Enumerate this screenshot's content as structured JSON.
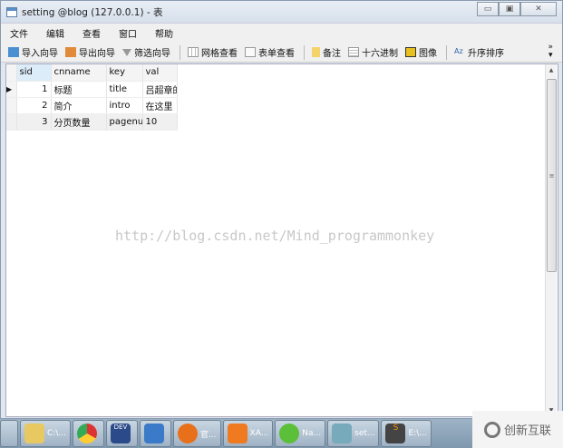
{
  "window": {
    "title": "setting @blog (127.0.0.1) - 表",
    "minimize": "▭",
    "maximize": "▣",
    "close": "✕"
  },
  "menu": [
    "文件",
    "编辑",
    "查看",
    "窗口",
    "帮助"
  ],
  "toolbar": {
    "import": "导入向导",
    "export": "导出向导",
    "filter": "筛选向导",
    "grid_view": "网格查看",
    "form_view": "表单查看",
    "memo": "备注",
    "hex": "十六进制",
    "image": "图像",
    "sort_asc": "升序排序",
    "more": "»"
  },
  "table": {
    "columns": [
      "sid",
      "cnname",
      "key",
      "val"
    ],
    "rows": [
      [
        "1",
        "标题",
        "title",
        "吕超章的"
      ],
      [
        "2",
        "简介",
        "intro",
        "在这里"
      ],
      [
        "3",
        "分页数量",
        "pagenu",
        "10"
      ]
    ]
  },
  "watermark": "http://blog.csdn.net/Mind_programmonkey",
  "taskbar": [
    {
      "label": "C:\\..."
    },
    {
      "label": ""
    },
    {
      "label": "DEV"
    },
    {
      "label": ""
    },
    {
      "label": "官..."
    },
    {
      "label": "XA..."
    },
    {
      "label": "Na..."
    },
    {
      "label": "set..."
    },
    {
      "label": "E:\\..."
    }
  ],
  "brand": "创新互联"
}
